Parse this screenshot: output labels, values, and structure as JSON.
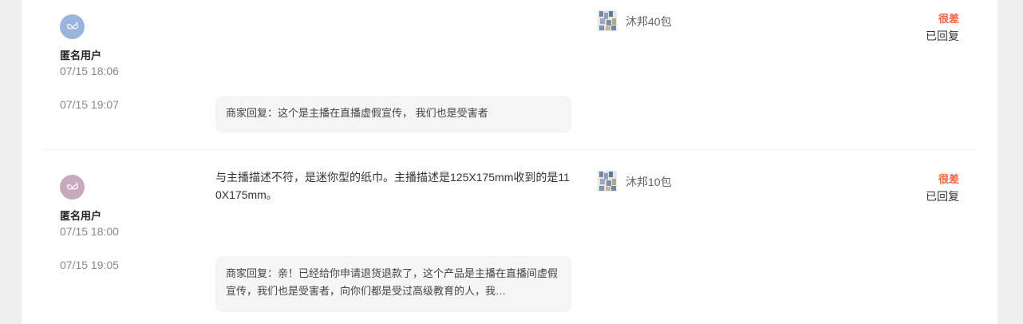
{
  "reviews": [
    {
      "avatar_color": "#9ab4dc",
      "username": "匿名用户",
      "review_time": "07/15 18:06",
      "reply_time": "07/15 19:07",
      "content": "",
      "reply": "商家回复：这个是主播在直播虚假宣传， 我们也是受害者",
      "product": "沐邦40包",
      "rating": "很差",
      "status": "已回复"
    },
    {
      "avatar_color": "#c8a8bc",
      "username": "匿名用户",
      "review_time": "07/15 18:00",
      "reply_time": "07/15 19:05",
      "content": "与主播描述不符，是迷你型的纸巾。主播描述是125X175mm收到的是110X175mm。",
      "reply": "商家回复：亲！已经给你申请退货退款了，这个产品是主播在直播间虚假宣传，我们也是受害者，向你们都是受过高级教育的人，我…",
      "product": "沐邦10包",
      "rating": "很差",
      "status": "已回复"
    }
  ],
  "colors": {
    "rating_bad": "#f06040",
    "page_bg": "#efefef",
    "reply_bg": "#f5f5f5"
  }
}
